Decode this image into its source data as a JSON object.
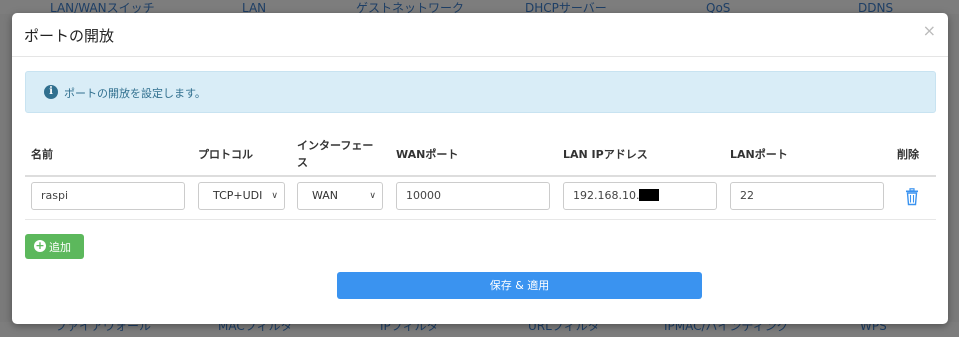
{
  "background": {
    "top_nav": [
      "LAN/WANスイッチ",
      "LAN",
      "ゲストネットワーク",
      "DHCPサーバー",
      "QoS",
      "DDNS"
    ],
    "bottom_nav": [
      "ファイアウォール",
      "MACフィルタ",
      "IPフィルタ",
      "URLフィルタ",
      "IPMAC/バインディング",
      "WPS"
    ]
  },
  "modal": {
    "title": "ポートの開放",
    "close_icon": "×",
    "info_icon": "i",
    "info_text": "ポートの開放を設定します。"
  },
  "table": {
    "headers": {
      "name": "名前",
      "protocol": "プロトコル",
      "interface_line1": "インターフェー",
      "interface_line2": "ス",
      "wan_port": "WANポート",
      "lan_ip": "LAN IPアドレス",
      "lan_port": "LANポート",
      "delete": "削除"
    },
    "row": {
      "name": "raspi",
      "protocol": "TCP+UDI",
      "interface": "WAN",
      "wan_port": "10000",
      "lan_ip_prefix": "192.168.10.",
      "lan_port": "22"
    }
  },
  "buttons": {
    "add_icon": "+",
    "add": "追加",
    "save": "保存 & 適用"
  },
  "colors": {
    "info_bg": "#d9edf7",
    "add_green": "#5cb85c",
    "save_blue": "#3a93f0",
    "trash_blue": "#3a93f0"
  }
}
